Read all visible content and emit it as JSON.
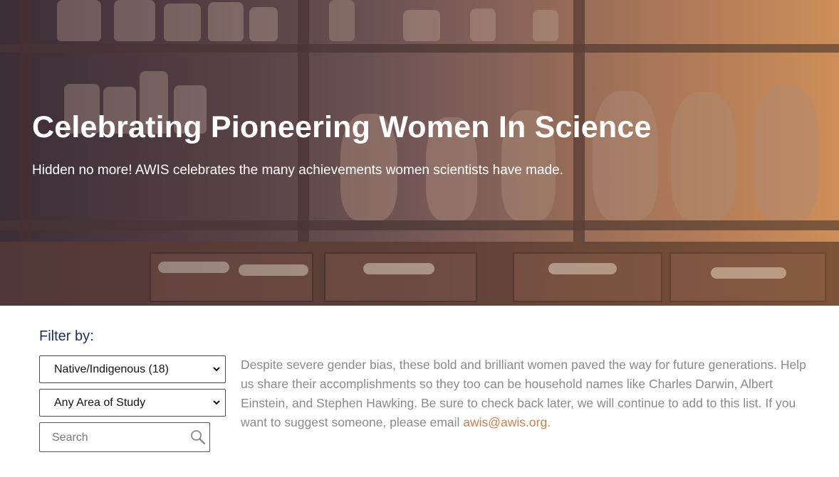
{
  "hero": {
    "title": "Celebrating Pioneering Women In Science",
    "subtitle": "Hidden no more! AWIS celebrates the many achievements women scientists have made."
  },
  "filters": {
    "label": "Filter by:",
    "group_select": {
      "selected": "Native/Indigenous (18)"
    },
    "area_select": {
      "selected": "Any Area of Study"
    },
    "search": {
      "placeholder": "Search",
      "value": ""
    }
  },
  "intro": {
    "text": "Despite severe gender bias, these bold and brilliant women paved the way for future generations. Help us share their accomplishments so they too can be household names like Charles Darwin, Albert Einstein, and Stephen Hawking. Be sure to check back later, we will continue to add to this list. If you want to suggest someone, please email ",
    "email_link": "awis@awis.org",
    "trailing": "."
  },
  "icons": {
    "search": "magnifier-icon",
    "dropdown": "chevron-down-icon"
  },
  "colors": {
    "heading_blue": "#1f2f5a",
    "link_orange": "#c8804d",
    "body_gray": "#8a8a8a"
  }
}
